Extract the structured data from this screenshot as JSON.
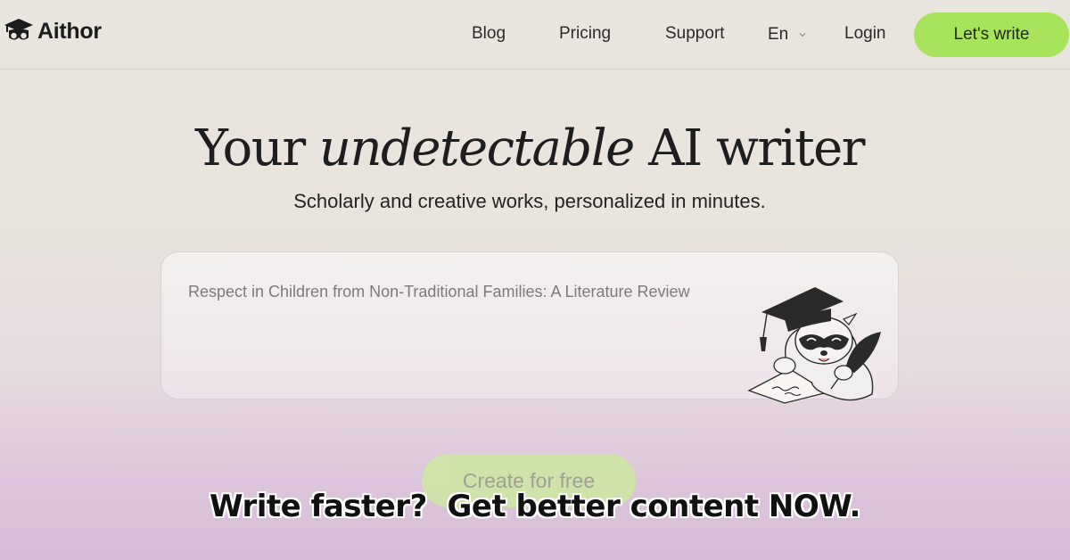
{
  "header": {
    "logo_text": "Aithor",
    "nav": {
      "blog": "Blog",
      "pricing": "Pricing",
      "support": "Support",
      "language": "En",
      "login": "Login",
      "cta": "Let's write"
    }
  },
  "hero": {
    "title_part1": "Your ",
    "title_italic": "undetectable",
    "title_part2": " AI writer",
    "subtitle": "Scholarly and creative works, personalized in minutes."
  },
  "input": {
    "placeholder": "Respect in Children from Non-Traditional Families: A Literature Review"
  },
  "create_button": "Create for free",
  "overlay_caption": "Write faster?  Get better content NOW.",
  "colors": {
    "accent": "#a7e35b",
    "background_top": "#e9e5df",
    "background_bottom": "#d6bfd6"
  },
  "icons": {
    "logo": "graduation-cap-mask-icon",
    "language_chevron": "chevron-down-icon",
    "mascot": "raccoon-graduate-illustration"
  }
}
